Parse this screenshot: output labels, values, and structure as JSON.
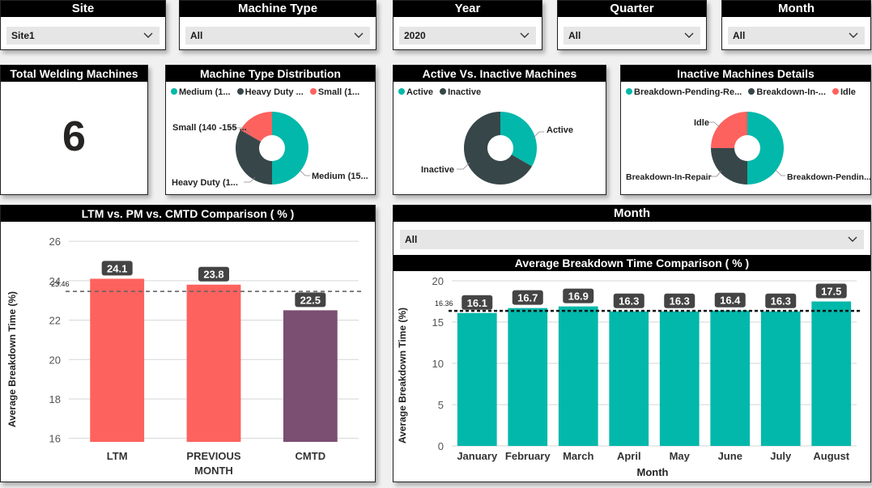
{
  "filters": [
    {
      "label": "Site",
      "value": "Site1"
    },
    {
      "label": "Machine Type",
      "value": "All"
    },
    {
      "label": "Year",
      "value": "2020"
    },
    {
      "label": "Quarter",
      "value": "All"
    },
    {
      "label": "Month",
      "value": "All"
    }
  ],
  "colors": {
    "teal": "#01B8AA",
    "dark": "#374649",
    "red": "#FD625E",
    "purple": "#7A4F72",
    "header_bg": "#000000"
  },
  "total_machines": {
    "title": "Total Welding Machines",
    "value": "6"
  },
  "machine_type": {
    "title": "Machine Type Distribution",
    "legend": [
      {
        "label": "Medium (1...",
        "color": "#01B8AA"
      },
      {
        "label": "Heavy Duty ...",
        "color": "#374649"
      },
      {
        "label": "Small (1...",
        "color": "#FD625E"
      }
    ],
    "slice_labels": {
      "small": "Small (140 -155 ...",
      "heavy": "Heavy Duty (1...",
      "medium": "Medium (15..."
    }
  },
  "active_inactive": {
    "title": "Active Vs. Inactive Machines",
    "legend": [
      {
        "label": "Active",
        "color": "#01B8AA"
      },
      {
        "label": "Inactive",
        "color": "#374649"
      }
    ],
    "slice_labels": {
      "active": "Active",
      "inactive": "Inactive"
    }
  },
  "inactive_details": {
    "title": "Inactive Machines Details",
    "legend": [
      {
        "label": "Breakdown-Pending-Re...",
        "color": "#01B8AA"
      },
      {
        "label": "Breakdown-In-...",
        "color": "#374649"
      },
      {
        "label": "Idle",
        "color": "#FD625E"
      }
    ],
    "slice_labels": {
      "idle": "Idle",
      "repair": "Breakdown-In-Repair",
      "pending": "Breakdown-Pendin..."
    }
  },
  "ltm_chart": {
    "title": "LTM vs. PM vs. CMTD Comparison ( % )"
  },
  "month_slicer": {
    "label": "Month",
    "value": "All"
  },
  "avg_chart": {
    "title": "Average Breakdown Time Comparison ( % )"
  },
  "chart_data": [
    {
      "type": "pie",
      "title": "Machine Type Distribution",
      "categories": [
        "Medium",
        "Heavy Duty",
        "Small"
      ],
      "values": [
        3,
        2,
        1
      ]
    },
    {
      "type": "pie",
      "title": "Active Vs. Inactive Machines",
      "categories": [
        "Active",
        "Inactive"
      ],
      "values": [
        2,
        4
      ]
    },
    {
      "type": "pie",
      "title": "Inactive Machines Details",
      "categories": [
        "Breakdown-Pending-Re...",
        "Breakdown-In-Repair",
        "Idle"
      ],
      "values": [
        2,
        1,
        1
      ]
    },
    {
      "type": "bar",
      "title": "LTM vs. PM vs. CMTD Comparison ( % )",
      "categories": [
        "LTM",
        "PREVIOUS MONTH",
        "CMTD"
      ],
      "values": [
        24.1,
        23.8,
        22.5
      ],
      "bar_colors": [
        "#FD625E",
        "#FD625E",
        "#7A4F72"
      ],
      "ylabel": "Average Breakdown Time (%)",
      "ylim": [
        15,
        26.5
      ],
      "yticks": [
        16,
        18,
        20,
        22,
        24,
        26
      ],
      "average_line": {
        "value": 23.46,
        "label": "23.46"
      },
      "grid": true
    },
    {
      "type": "bar",
      "title": "Average Breakdown Time Comparison ( % )",
      "categories": [
        "January",
        "February",
        "March",
        "April",
        "May",
        "June",
        "July",
        "August"
      ],
      "values": [
        16.1,
        16.7,
        16.9,
        16.3,
        16.3,
        16.4,
        16.3,
        17.5
      ],
      "bar_color": "#01B8AA",
      "xlabel": "Month",
      "ylabel": "Average Breakdown Time (%)",
      "ylim": [
        0,
        20
      ],
      "yticks": [
        0,
        5,
        10,
        15,
        20
      ],
      "average_line": {
        "value": 16.36,
        "label": "16.36"
      },
      "grid": true
    }
  ]
}
